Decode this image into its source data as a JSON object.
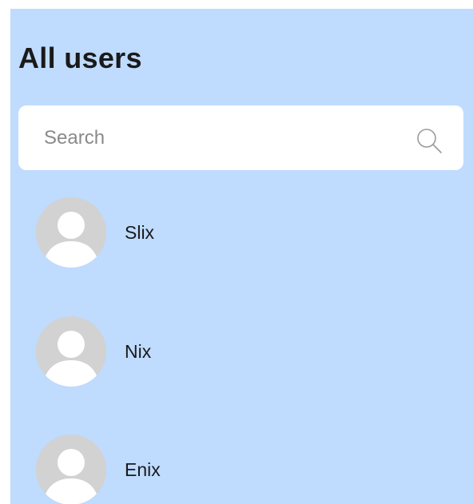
{
  "header": {
    "title": "All users"
  },
  "search": {
    "placeholder": "Search",
    "value": "",
    "icon": "search-icon"
  },
  "users": [
    {
      "name": "Slix",
      "avatar": "default-avatar-icon"
    },
    {
      "name": "Nix",
      "avatar": "default-avatar-icon"
    },
    {
      "name": "Enix",
      "avatar": "default-avatar-icon"
    }
  ],
  "colors": {
    "panel_background": "#bfdbfe",
    "avatar_background": "#d2d2d2",
    "text": "#1a1a1a"
  }
}
